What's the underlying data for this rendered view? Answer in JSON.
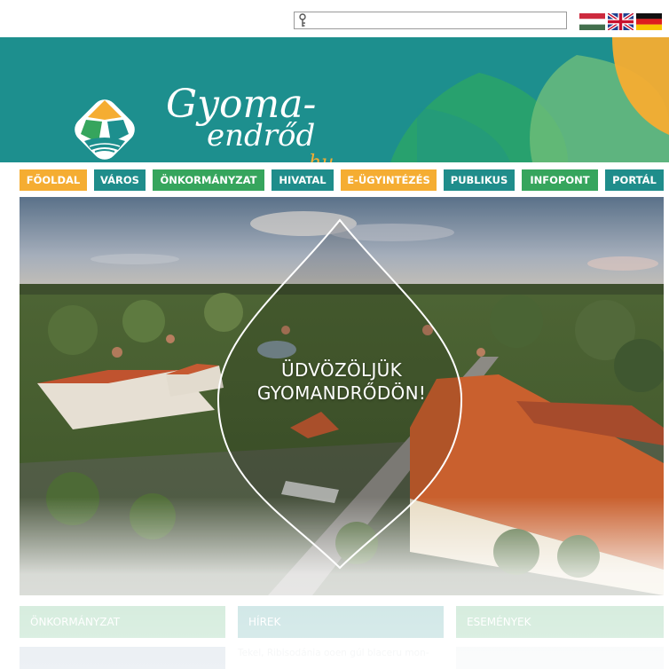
{
  "search": {
    "placeholder": "",
    "value": ""
  },
  "flags": [
    {
      "label": "Magyar",
      "icon": "hungary-flag-icon"
    },
    {
      "label": "English",
      "icon": "uk-flag-icon"
    },
    {
      "label": "Deutsch",
      "icon": "germany-flag-icon"
    }
  ],
  "header": {
    "logo_script_line1": "Gyoma-",
    "logo_script_line2": "endrőd",
    "logo_script_suffix": ".hu",
    "colors": {
      "teal": "#1d8f8e",
      "orange": "#f5ad32",
      "green": "#36a55d"
    }
  },
  "nav": [
    {
      "label": "FŐOLDAL",
      "color": "orange"
    },
    {
      "label": "VÁROS",
      "color": "teal"
    },
    {
      "label": "ÖNKORMÁNYZAT",
      "color": "green"
    },
    {
      "label": "HIVATAL",
      "color": "teal"
    },
    {
      "label": "E-ÜGYINTÉZÉS",
      "color": "orange"
    },
    {
      "label": "PUBLIKUS",
      "color": "teal"
    },
    {
      "label": "INFOPONT",
      "color": "green"
    },
    {
      "label": "PORTÁL",
      "color": "teal"
    }
  ],
  "hero": {
    "title_line1": "ÜDVÖZÖLJÜK",
    "title_line2": "GYOMANDRŐDÖN!"
  },
  "sections": [
    {
      "title": "ÖNKORMÁNYZAT"
    },
    {
      "title": "HÍREK"
    },
    {
      "title": "ESEMÉNYEK"
    }
  ],
  "news_preview": "Tekel, Ribisodánia ooen gúl blaceru mon-"
}
